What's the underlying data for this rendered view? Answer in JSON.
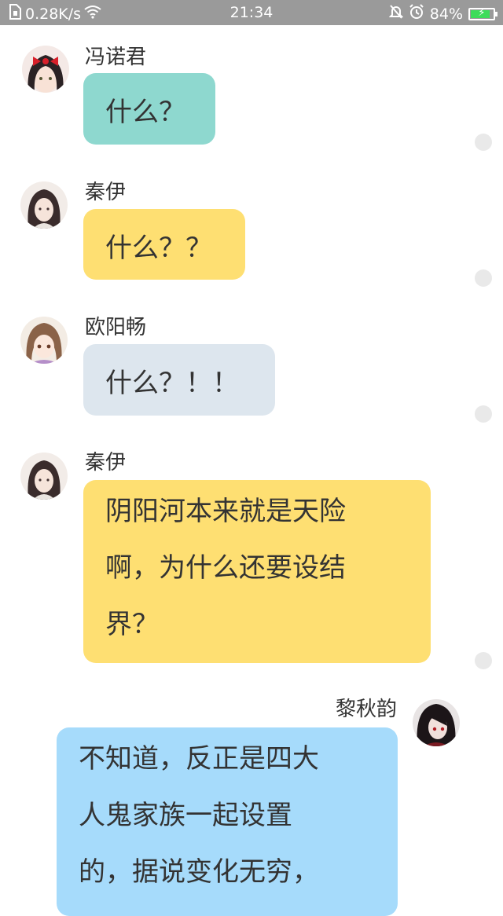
{
  "status_bar": {
    "network_speed": "0.28K/s",
    "time": "21:34",
    "battery_percent": "84%",
    "battery_level": 0.84,
    "icons": [
      "sim-icon",
      "wifi-icon",
      "bell-muted-icon",
      "alarm-icon",
      "battery-icon"
    ]
  },
  "colors": {
    "teal_bubble": "#8ed8cf",
    "yellow_bubble": "#fedf72",
    "grey_bubble": "#dde6ee",
    "blue_bubble": "#a6dbfb"
  },
  "messages": [
    {
      "sender": "冯诺君",
      "text": "什么？"
    },
    {
      "sender": "秦伊",
      "text": "什么？？"
    },
    {
      "sender": "欧阳畅",
      "text": "什么？！！"
    },
    {
      "sender": "秦伊",
      "text": "阴阳河本来就是天险\n啊，为什么还要设结\n界？"
    },
    {
      "sender": "黎秋韵",
      "text": "不知道，反正是四大\n人鬼家族一起设置\n的，据说变化无穷，"
    }
  ]
}
